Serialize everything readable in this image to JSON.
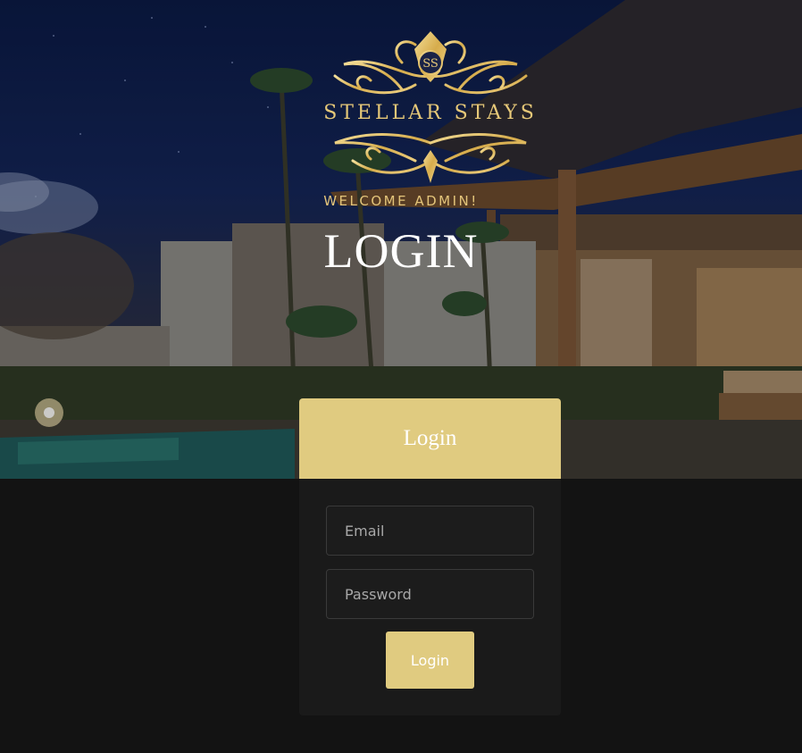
{
  "brand": {
    "name": "STELLAR STAYS",
    "monogram": "SS"
  },
  "hero": {
    "welcome": "WELCOME ADMIN!",
    "title": "LOGIN"
  },
  "login_card": {
    "header": "Login",
    "email": {
      "placeholder": "Email",
      "value": ""
    },
    "password": {
      "placeholder": "Password",
      "value": ""
    },
    "submit_label": "Login"
  },
  "colors": {
    "accent_gold": "#e0cb80",
    "logo_gold": "#e6c878",
    "page_background": "#131313",
    "card_background": "#1a1a1a"
  }
}
